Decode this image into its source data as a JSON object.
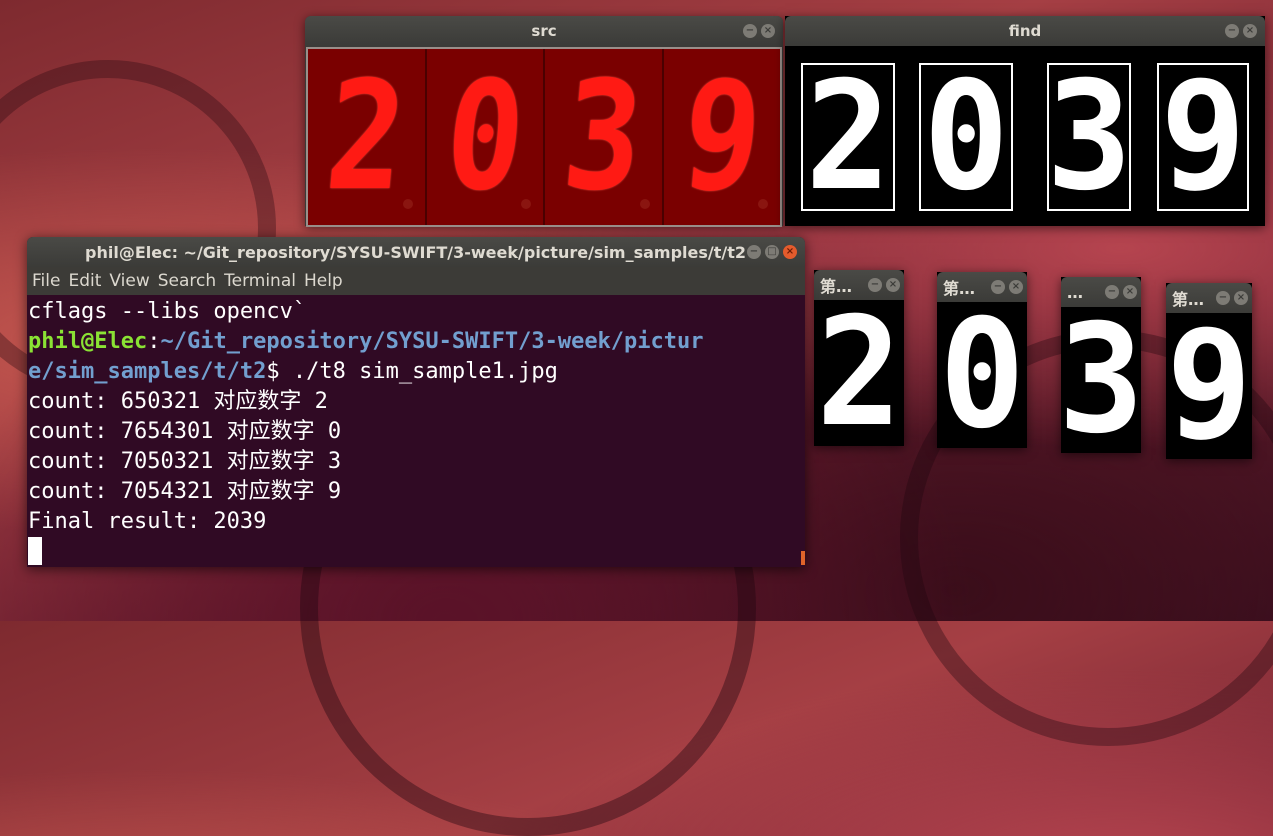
{
  "src_window": {
    "title": "src",
    "digits": [
      "2",
      "0",
      "3",
      "9"
    ]
  },
  "find_window": {
    "title": "find",
    "digits": [
      "2",
      "0",
      "3",
      "9"
    ]
  },
  "small_windows": [
    {
      "title": "第…",
      "digit": "2"
    },
    {
      "title": "第…",
      "digit": "0"
    },
    {
      "title": "…",
      "digit": "3"
    },
    {
      "title": "第…",
      "digit": "9"
    }
  ],
  "terminal": {
    "title": "phil@Elec: ~/Git_repository/SYSU-SWIFT/3-week/picture/sim_samples/t/t2",
    "menu": [
      "File",
      "Edit",
      "View",
      "Search",
      "Terminal",
      "Help"
    ],
    "line1": "cflags --libs opencv`",
    "prompt_user": "phil@Elec",
    "prompt_path_1": "~/Git_repository/SYSU-SWIFT/3-week/pictur",
    "prompt_path_2": "e/sim_samples/t/t2",
    "command": "$ ./t8 sim_sample1.jpg",
    "out1": "count: 650321 对应数字 2",
    "out2": "count: 7654301 对应数字 0",
    "out3": "count: 7050321 对应数字 3",
    "out4": "count: 7054321 对应数字 9",
    "result": "Final result: 2039"
  },
  "window_buttons": {
    "minimize": "−",
    "close": "×"
  }
}
